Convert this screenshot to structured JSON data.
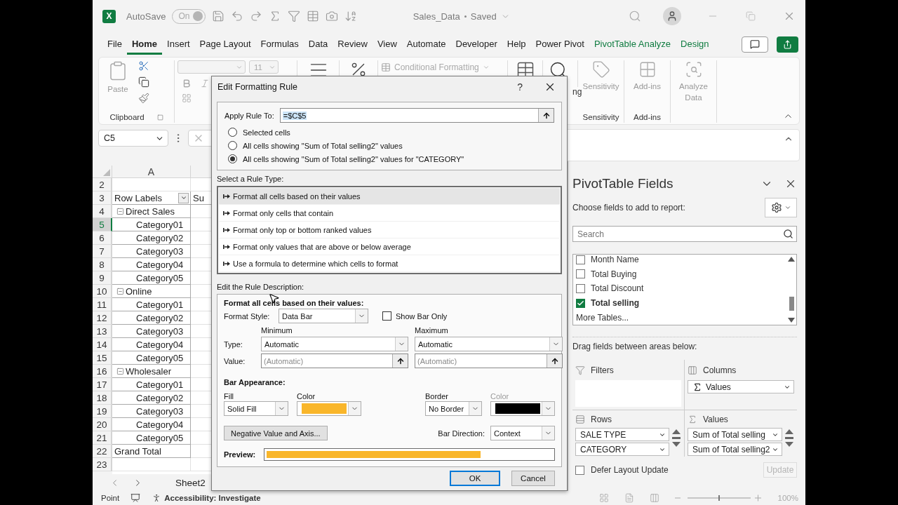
{
  "title_bar": {
    "logo_letter": "X",
    "autosave_label": "AutoSave",
    "autosave_toggle": {
      "label": "On",
      "on": true,
      "disabled": true
    },
    "document": "Sales_Data",
    "save_state": "Saved"
  },
  "menu_tabs": [
    {
      "label": "File",
      "selected": false,
      "kind": "standard"
    },
    {
      "label": "Home",
      "selected": true,
      "kind": "standard"
    },
    {
      "label": "Insert",
      "selected": false,
      "kind": "standard"
    },
    {
      "label": "Page Layout",
      "selected": false,
      "kind": "standard"
    },
    {
      "label": "Formulas",
      "selected": false,
      "kind": "standard"
    },
    {
      "label": "Data",
      "selected": false,
      "kind": "standard"
    },
    {
      "label": "Review",
      "selected": false,
      "kind": "standard"
    },
    {
      "label": "View",
      "selected": false,
      "kind": "standard"
    },
    {
      "label": "Automate",
      "selected": false,
      "kind": "standard"
    },
    {
      "label": "Developer",
      "selected": false,
      "kind": "standard"
    },
    {
      "label": "Help",
      "selected": false,
      "kind": "standard"
    },
    {
      "label": "Power Pivot",
      "selected": false,
      "kind": "standard"
    },
    {
      "label": "PivotTable Analyze",
      "selected": false,
      "kind": "contextual"
    },
    {
      "label": "Design",
      "selected": false,
      "kind": "contextual"
    }
  ],
  "ribbon": {
    "clipboard": {
      "paste": "Paste",
      "group": "Clipboard"
    },
    "font_size": "11",
    "conditional_formatting": "Conditional Formatting",
    "editing_fragment": "ng",
    "sensitivity": {
      "button": "Sensitivity",
      "group": "Sensitivity"
    },
    "add_ins": {
      "button": "Add-ins",
      "group": "Add-ins"
    },
    "analyze_data": "Analyze Data"
  },
  "formula_bar": {
    "name_box": "C5"
  },
  "sheet": {
    "column_header": "A",
    "rows": [
      {
        "number": "2",
        "kind": "blank",
        "selected": false
      },
      {
        "number": "3",
        "kind": "header",
        "label": "Row Labels",
        "column_b": "Su",
        "selected": false
      },
      {
        "number": "4",
        "kind": "group",
        "label": "Direct Sales",
        "expanded": true,
        "selected": false
      },
      {
        "number": "5",
        "kind": "item",
        "label": "Category01",
        "selected": true
      },
      {
        "number": "6",
        "kind": "item",
        "label": "Category02",
        "selected": false
      },
      {
        "number": "7",
        "kind": "item",
        "label": "Category03",
        "selected": false
      },
      {
        "number": "8",
        "kind": "item",
        "label": "Category04",
        "selected": false
      },
      {
        "number": "9",
        "kind": "item",
        "label": "Category05",
        "selected": false
      },
      {
        "number": "10",
        "kind": "group",
        "label": "Online",
        "expanded": true,
        "selected": false
      },
      {
        "number": "11",
        "kind": "item",
        "label": "Category01",
        "selected": false
      },
      {
        "number": "12",
        "kind": "item",
        "label": "Category02",
        "selected": false
      },
      {
        "number": "13",
        "kind": "item",
        "label": "Category03",
        "selected": false
      },
      {
        "number": "14",
        "kind": "item",
        "label": "Category04",
        "selected": false
      },
      {
        "number": "15",
        "kind": "item",
        "label": "Category05",
        "selected": false
      },
      {
        "number": "16",
        "kind": "group",
        "label": "Wholesaler",
        "expanded": true,
        "selected": false
      },
      {
        "number": "17",
        "kind": "item",
        "label": "Category01",
        "selected": false
      },
      {
        "number": "18",
        "kind": "item",
        "label": "Category02",
        "selected": false
      },
      {
        "number": "19",
        "kind": "item",
        "label": "Category03",
        "selected": false
      },
      {
        "number": "20",
        "kind": "item",
        "label": "Category04",
        "selected": false
      },
      {
        "number": "21",
        "kind": "item",
        "label": "Category05",
        "selected": false
      },
      {
        "number": "22",
        "kind": "total",
        "label": "Grand Total",
        "selected": false
      },
      {
        "number": "23",
        "kind": "blank",
        "selected": false
      }
    ]
  },
  "sheet_tab": "Sheet2",
  "status_bar": {
    "mode": "Point",
    "accessibility": "Accessibility: Investigate",
    "zoom_slider": {
      "level": 0.5
    },
    "zoom": "100%"
  },
  "pivot_fields": {
    "title": "PivotTable Fields",
    "subtitle": "Choose fields to add to report:",
    "search_placeholder": "Search",
    "fields": [
      {
        "label": "Month Name",
        "checked": false
      },
      {
        "label": "Total Buying",
        "checked": false
      },
      {
        "label": "Total Discount",
        "checked": false
      },
      {
        "label": "Total selling",
        "checked": true
      }
    ],
    "more_tables": "More Tables...",
    "drag_label": "Drag fields between areas below:",
    "areas": [
      {
        "kind": "filters",
        "title": "Filters"
      },
      {
        "kind": "columns",
        "title": "Columns",
        "items": [
          {
            "label": "Values",
            "kind": "sigma"
          }
        ]
      },
      {
        "kind": "rows",
        "title": "Rows",
        "items": [
          {
            "label": "SALE TYPE",
            "kind": "field"
          },
          {
            "label": "CATEGORY",
            "kind": "field"
          }
        ]
      },
      {
        "kind": "values",
        "title": "Values",
        "items": [
          {
            "label": "Sum of Total selling",
            "kind": "field"
          },
          {
            "label": "Sum of Total selling2",
            "kind": "field"
          }
        ]
      }
    ],
    "defer": {
      "label": "Defer Layout Update",
      "checked": false
    },
    "update_button": {
      "label": "Update",
      "disabled": true
    }
  },
  "dialog": {
    "title": "Edit Formatting Rule",
    "help": "?",
    "apply_label": "Apply Rule To:",
    "apply_value": "=$C$5",
    "scope_options": [
      {
        "label": "Selected cells",
        "selected": false
      },
      {
        "label": "All cells showing \"Sum of Total selling2\" values",
        "selected": false
      },
      {
        "label": "All cells showing \"Sum of Total selling2\" values for \"CATEGORY\"",
        "selected": true
      }
    ],
    "rule_type_label": "Select a Rule Type:",
    "rule_types": [
      {
        "label": "Format all cells based on their values",
        "selected": true
      },
      {
        "label": "Format only cells that contain",
        "selected": false
      },
      {
        "label": "Format only top or bottom ranked values",
        "selected": false
      },
      {
        "label": "Format only values that are above or below average",
        "selected": false
      },
      {
        "label": "Use a formula to determine which cells to format",
        "selected": false
      }
    ],
    "description_label": "Edit the Rule Description:",
    "description_heading": "Format all cells based on their values:",
    "format_style": {
      "label": "Format Style:",
      "value": "Data Bar"
    },
    "show_bar_only": {
      "label": "Show Bar Only",
      "checked": false
    },
    "type_label": "Type:",
    "value_label": "Value:",
    "minimum": {
      "heading": "Minimum",
      "type": "Automatic",
      "value_placeholder": "(Automatic)"
    },
    "maximum": {
      "heading": "Maximum",
      "type": "Automatic",
      "value_placeholder": "(Automatic)"
    },
    "bar_appearance_label": "Bar Appearance:",
    "fill": {
      "label": "Fill",
      "value": "Solid Fill"
    },
    "fill_color": {
      "label": "Color",
      "color": "#f9b62a",
      "disabled": false
    },
    "border": {
      "label": "Border",
      "value": "No Border"
    },
    "border_color": {
      "label": "Color",
      "color": "#000000",
      "disabled": true
    },
    "negative_button": "Negative Value and Axis...",
    "bar_direction": {
      "label": "Bar Direction:",
      "value": "Context"
    },
    "preview": {
      "label": "Preview:",
      "level": 0.75
    },
    "buttons": [
      {
        "label": "OK",
        "kind": "default"
      },
      {
        "label": "Cancel",
        "kind": "normal"
      }
    ]
  }
}
